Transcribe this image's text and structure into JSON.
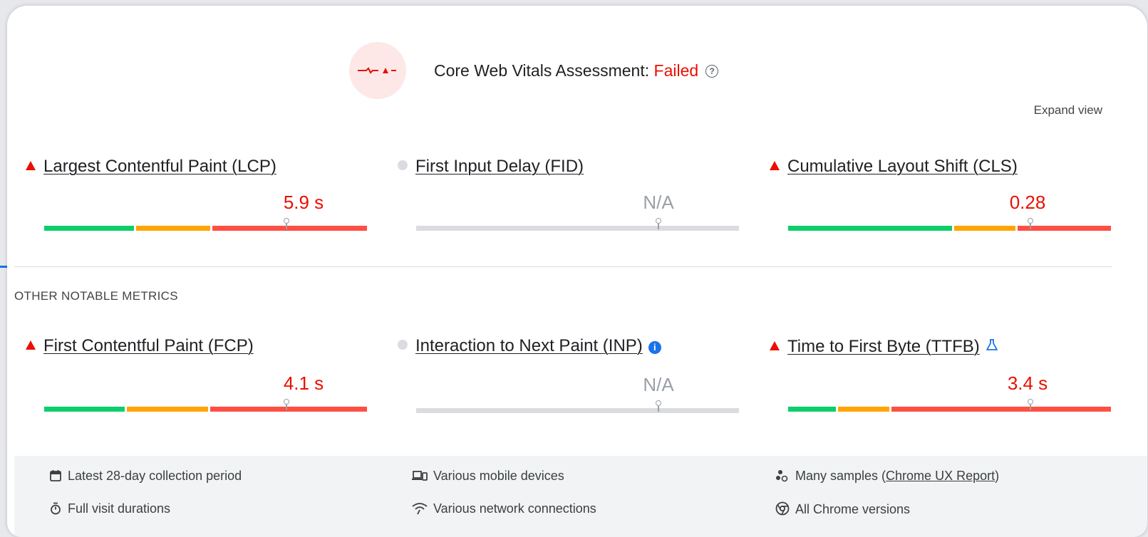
{
  "assessment": {
    "title_prefix": "Core Web Vitals Assessment: ",
    "status": "Failed",
    "icon": "vitals-failed-icon",
    "help_icon": "question-circle-icon",
    "help_glyph": "?"
  },
  "expand_view": "Expand view",
  "core_metrics": [
    {
      "name": "Largest Contentful Paint (LCP)",
      "value": "5.9 s",
      "status": "poor",
      "indicator": "red-triangle-icon",
      "distribution": [
        0.285,
        0.235,
        0.48
      ],
      "marker": 0.75
    },
    {
      "name": "First Input Delay (FID)",
      "value": "N/A",
      "status": "none",
      "indicator": "grey-circle-icon",
      "marker": 0.75
    },
    {
      "name": "Cumulative Layout Shift (CLS)",
      "value": "0.28",
      "status": "poor",
      "indicator": "red-triangle-icon",
      "distribution": [
        0.515,
        0.195,
        0.29
      ],
      "marker": 0.75
    }
  ],
  "other_heading": "OTHER NOTABLE METRICS",
  "other_metrics": [
    {
      "name": "First Contentful Paint (FCP)",
      "value": "4.1 s",
      "status": "poor",
      "indicator": "red-triangle-icon",
      "distribution": [
        0.255,
        0.26,
        0.485
      ],
      "marker": 0.75
    },
    {
      "name": "Interaction to Next Paint (INP)",
      "value": "N/A",
      "status": "none",
      "indicator": "grey-circle-icon",
      "badge": "info-icon",
      "badge_glyph": "i",
      "marker": 0.75
    },
    {
      "name": "Time to First Byte (TTFB)",
      "value": "3.4 s",
      "status": "poor",
      "indicator": "red-triangle-icon",
      "badge": "experimental-flask-icon",
      "distribution": [
        0.155,
        0.165,
        0.68
      ],
      "marker": 0.75
    }
  ],
  "footer": {
    "period": "Latest 28-day collection period",
    "devices": "Various mobile devices",
    "samples_prefix": "Many samples (",
    "samples_link": "Chrome UX Report",
    "samples_suffix": ")",
    "durations": "Full visit durations",
    "network": "Various network connections",
    "versions": "All Chrome versions"
  },
  "colors": {
    "good": "#0cce6b",
    "needs_improvement": "#ffa400",
    "poor": "#ff4e42",
    "failed_text": "#eb0f00",
    "na_bar": "#dadce0"
  }
}
